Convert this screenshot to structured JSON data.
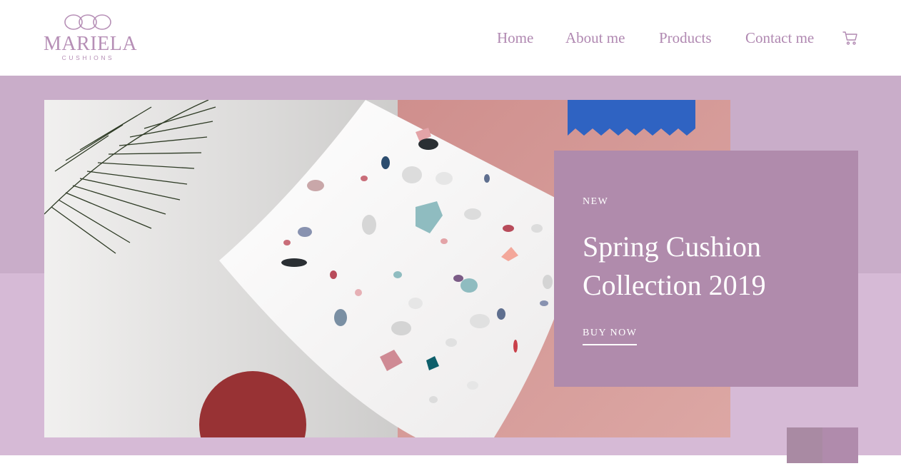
{
  "brand": {
    "name": "MARIELA",
    "tagline": "CUSHIONS"
  },
  "nav": {
    "items": [
      {
        "label": "Home"
      },
      {
        "label": "About me"
      },
      {
        "label": "Products"
      },
      {
        "label": "Contact me"
      }
    ],
    "cart_icon": "cart-icon"
  },
  "hero": {
    "image": "terrazzo-cushion-photo",
    "tag": "NEW",
    "title": "Spring Cushion Collection 2019",
    "cta": "BUY NOW"
  },
  "colors": {
    "accent": "#b08bac",
    "band_top": "#c9adc9",
    "band_bottom": "#d6bad6",
    "brand": "#b68fb6"
  }
}
